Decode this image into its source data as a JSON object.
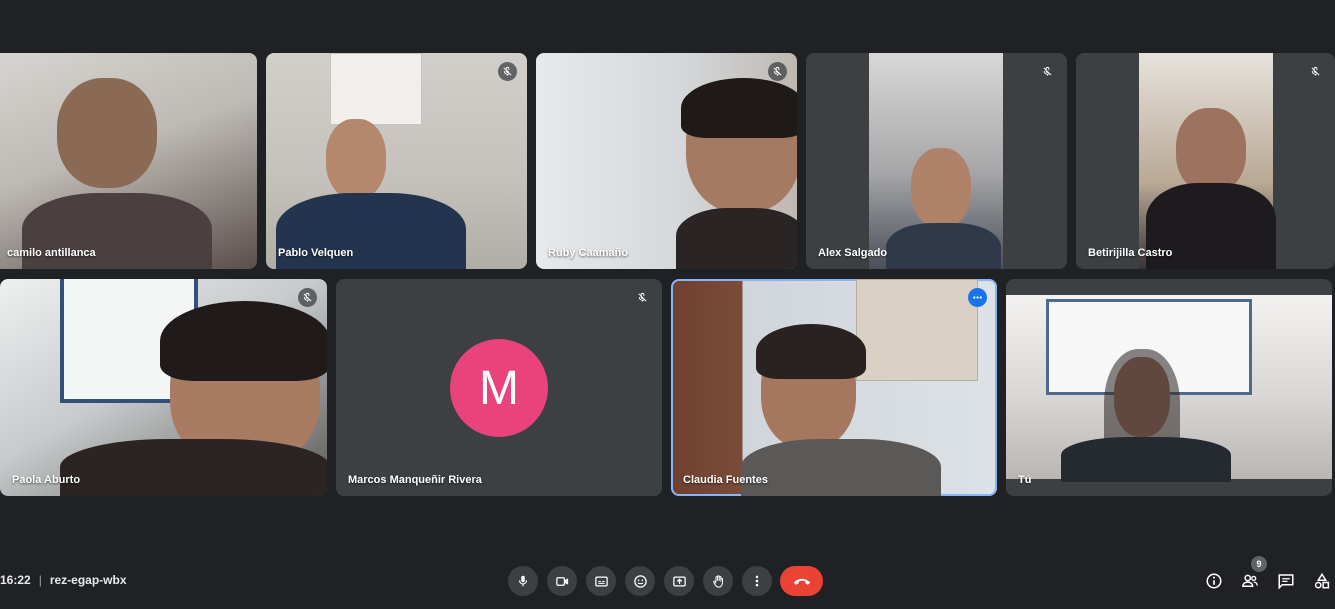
{
  "participants": [
    {
      "name": "camilo antillanca",
      "muted": false
    },
    {
      "name": "Pablo Velquen",
      "muted": true
    },
    {
      "name": "Ruby Caamaño",
      "muted": true
    },
    {
      "name": "Alex Salgado",
      "muted": true
    },
    {
      "name": "Betirijilla Castro",
      "muted": true
    },
    {
      "name": "Paola Aburto",
      "muted": true
    },
    {
      "name": "Marcos Manqueñir Rivera",
      "muted": true,
      "avatar_letter": "M"
    },
    {
      "name": "Claudia Fuentes",
      "muted": false,
      "speaking": true
    },
    {
      "name": "Tú",
      "muted": false
    }
  ],
  "meeting": {
    "time": "16:22",
    "code": "rez-egap-wbx"
  },
  "people_count": "9",
  "colors": {
    "background": "#202124",
    "tile": "#3c4043",
    "end_call": "#ea4335",
    "avatar": "#e8437b",
    "active_border": "#8ab4f8"
  },
  "controls": [
    "mic-icon",
    "camera-icon",
    "captions-icon",
    "emoji-icon",
    "present-icon",
    "raise-hand-icon",
    "more-options-icon",
    "end-call-icon"
  ],
  "right_controls": [
    "info-icon",
    "people-icon",
    "chat-icon",
    "activities-icon"
  ]
}
